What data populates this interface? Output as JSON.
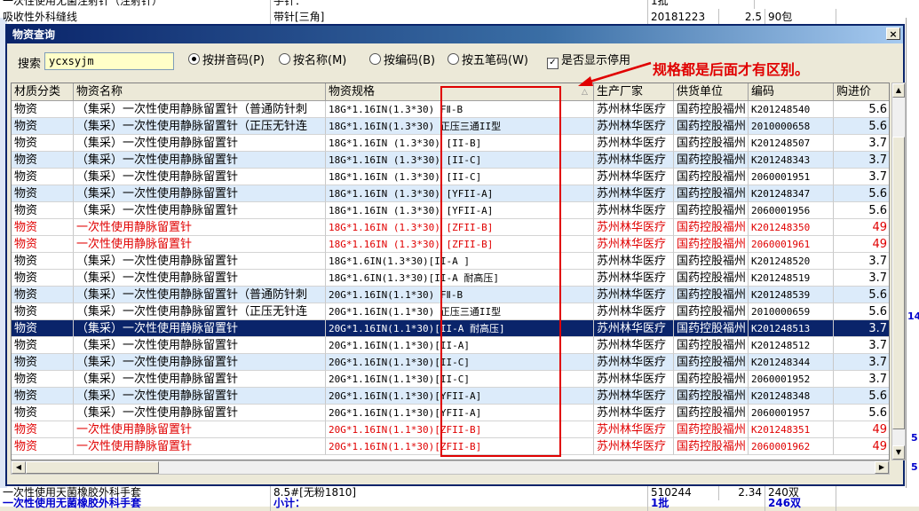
{
  "background": {
    "top_rows": [
      {
        "name": "一次性使用无菌注射针（注射针）",
        "spec": "手针：",
        "unit": "1批"
      },
      {
        "name": "吸收性外科缝线",
        "spec": "带针[三角]",
        "date": "20181223",
        "price": "2.5",
        "qty": "90包"
      }
    ],
    "bottom_rows": [
      {
        "name": "一次性使用天菌橡胶外科手套",
        "spec": "8.5#[无粉1810]",
        "date": "510244",
        "price": "2.34",
        "qty": "240双"
      },
      {
        "name": "一次性使用无菌橡胶外科手套",
        "spec": "小计：",
        "unit": "1批",
        "qty": "246双"
      }
    ],
    "right_marks": [
      "14",
      "5",
      "5"
    ]
  },
  "dialog": {
    "title": "物资查询",
    "close": "×",
    "search_label": "搜索",
    "search_value": "ycxsyjm",
    "options": [
      {
        "label": "按拼音码(P)",
        "selected": true
      },
      {
        "label": "按名称(M)",
        "selected": false
      },
      {
        "label": "按编码(B)",
        "selected": false
      },
      {
        "label": "按五笔码(W)",
        "selected": false
      }
    ],
    "show_disabled_label": "是否显示停用",
    "show_disabled_checked": true,
    "annotation": "规格都是后面才有区别。",
    "annotation_color": "#e00000"
  },
  "grid": {
    "columns": [
      "材质分类",
      "物资名称",
      "物资规格",
      "生产厂家",
      "供货单位",
      "编码",
      "购进价"
    ],
    "rows": [
      {
        "cat": "物资",
        "name": "（集采）一次性使用静脉留置针（普通防针刺",
        "spec": "18G*1.16IN(1.3*30) FⅡ-B",
        "maker": "苏州林华医疗",
        "supplier": "国药控股福州",
        "code": "K201248540",
        "price": "5.6",
        "style": "normal"
      },
      {
        "cat": "物资",
        "name": "（集采）一次性使用静脉留置针（正压无针连",
        "spec": "18G*1.16IN(1.3*30) 正压三通II型",
        "maker": "苏州林华医疗",
        "supplier": "国药控股福州",
        "code": "2010000658",
        "price": "5.6",
        "style": "alt"
      },
      {
        "cat": "物资",
        "name": "（集采）一次性使用静脉留置针",
        "spec": "18G*1.16IN (1.3*30) [II-B]",
        "maker": "苏州林华医疗",
        "supplier": "国药控股福州",
        "code": "K201248507",
        "price": "3.7",
        "style": "normal"
      },
      {
        "cat": "物资",
        "name": "（集采）一次性使用静脉留置针",
        "spec": "18G*1.16IN (1.3*30) [II-C]",
        "maker": "苏州林华医疗",
        "supplier": "国药控股福州",
        "code": "K201248343",
        "price": "3.7",
        "style": "alt"
      },
      {
        "cat": "物资",
        "name": "（集采）一次性使用静脉留置针",
        "spec": "18G*1.16IN (1.3*30) [II-C]",
        "maker": "苏州林华医疗",
        "supplier": "国药控股福州",
        "code": "2060001951",
        "price": "3.7",
        "style": "normal"
      },
      {
        "cat": "物资",
        "name": "（集采）一次性使用静脉留置针",
        "spec": "18G*1.16IN (1.3*30) [YFII-A]",
        "maker": "苏州林华医疗",
        "supplier": "国药控股福州",
        "code": "K201248347",
        "price": "5.6",
        "style": "alt"
      },
      {
        "cat": "物资",
        "name": "（集采）一次性使用静脉留置针",
        "spec": "18G*1.16IN (1.3*30) [YFII-A]",
        "maker": "苏州林华医疗",
        "supplier": "国药控股福州",
        "code": "2060001956",
        "price": "5.6",
        "style": "normal"
      },
      {
        "cat": "物资",
        "name": "一次性使用静脉留置针",
        "spec": "18G*1.16IN (1.3*30) [ZFII-B]",
        "maker": "苏州林华医疗",
        "supplier": "国药控股福州",
        "code": "K201248350",
        "price": "49",
        "style": "red"
      },
      {
        "cat": "物资",
        "name": "一次性使用静脉留置针",
        "spec": "18G*1.16IN (1.3*30) [ZFII-B]",
        "maker": "苏州林华医疗",
        "supplier": "国药控股福州",
        "code": "2060001961",
        "price": "49",
        "style": "red"
      },
      {
        "cat": "物资",
        "name": "（集采）一次性使用静脉留置针",
        "spec": "18G*1.6IN(1.3*30)[II-A ]",
        "maker": "苏州林华医疗",
        "supplier": "国药控股福州",
        "code": "K201248520",
        "price": "3.7",
        "style": "normal"
      },
      {
        "cat": "物资",
        "name": "（集采）一次性使用静脉留置针",
        "spec": "18G*1.6IN(1.3*30)[II-A 耐高压]",
        "maker": "苏州林华医疗",
        "supplier": "国药控股福州",
        "code": "K201248519",
        "price": "3.7",
        "style": "normal"
      },
      {
        "cat": "物资",
        "name": "（集采）一次性使用静脉留置针（普通防针刺",
        "spec": "20G*1.16IN(1.1*30) FⅡ-B",
        "maker": "苏州林华医疗",
        "supplier": "国药控股福州",
        "code": "K201248539",
        "price": "5.6",
        "style": "alt"
      },
      {
        "cat": "物资",
        "name": "（集采）一次性使用静脉留置针（正压无针连",
        "spec": "20G*1.16IN(1.1*30) 正压三通II型",
        "maker": "苏州林华医疗",
        "supplier": "国药控股福州",
        "code": "2010000659",
        "price": "5.6",
        "style": "normal"
      },
      {
        "cat": "物资",
        "name": "（集采）一次性使用静脉留置针",
        "spec": "20G*1.16IN(1.1*30)[II-A 耐高压]",
        "maker": "苏州林华医疗",
        "supplier": "国药控股福州",
        "code": "K201248513",
        "price": "3.7",
        "style": "sel"
      },
      {
        "cat": "物资",
        "name": "（集采）一次性使用静脉留置针",
        "spec": "20G*1.16IN(1.1*30)[II-A]",
        "maker": "苏州林华医疗",
        "supplier": "国药控股福州",
        "code": "K201248512",
        "price": "3.7",
        "style": "normal"
      },
      {
        "cat": "物资",
        "name": "（集采）一次性使用静脉留置针",
        "spec": "20G*1.16IN(1.1*30)[II-C]",
        "maker": "苏州林华医疗",
        "supplier": "国药控股福州",
        "code": "K201248344",
        "price": "3.7",
        "style": "alt"
      },
      {
        "cat": "物资",
        "name": "（集采）一次性使用静脉留置针",
        "spec": "20G*1.16IN(1.1*30)[II-C]",
        "maker": "苏州林华医疗",
        "supplier": "国药控股福州",
        "code": "2060001952",
        "price": "3.7",
        "style": "normal"
      },
      {
        "cat": "物资",
        "name": "（集采）一次性使用静脉留置针",
        "spec": "20G*1.16IN(1.1*30)[YFII-A]",
        "maker": "苏州林华医疗",
        "supplier": "国药控股福州",
        "code": "K201248348",
        "price": "5.6",
        "style": "alt"
      },
      {
        "cat": "物资",
        "name": "（集采）一次性使用静脉留置针",
        "spec": "20G*1.16IN(1.1*30)[YFII-A]",
        "maker": "苏州林华医疗",
        "supplier": "国药控股福州",
        "code": "2060001957",
        "price": "5.6",
        "style": "normal"
      },
      {
        "cat": "物资",
        "name": "一次性使用静脉留置针",
        "spec": "20G*1.16IN(1.1*30)[ZFII-B]",
        "maker": "苏州林华医疗",
        "supplier": "国药控股福州",
        "code": "K201248351",
        "price": "49",
        "style": "red"
      },
      {
        "cat": "物资",
        "name": "一次性使用静脉留置针",
        "spec": "20G*1.16IN(1.1*30)[ZFII-B]",
        "maker": "苏州林华医疗",
        "supplier": "国药控股福州",
        "code": "2060001962",
        "price": "49",
        "style": "red"
      }
    ]
  }
}
